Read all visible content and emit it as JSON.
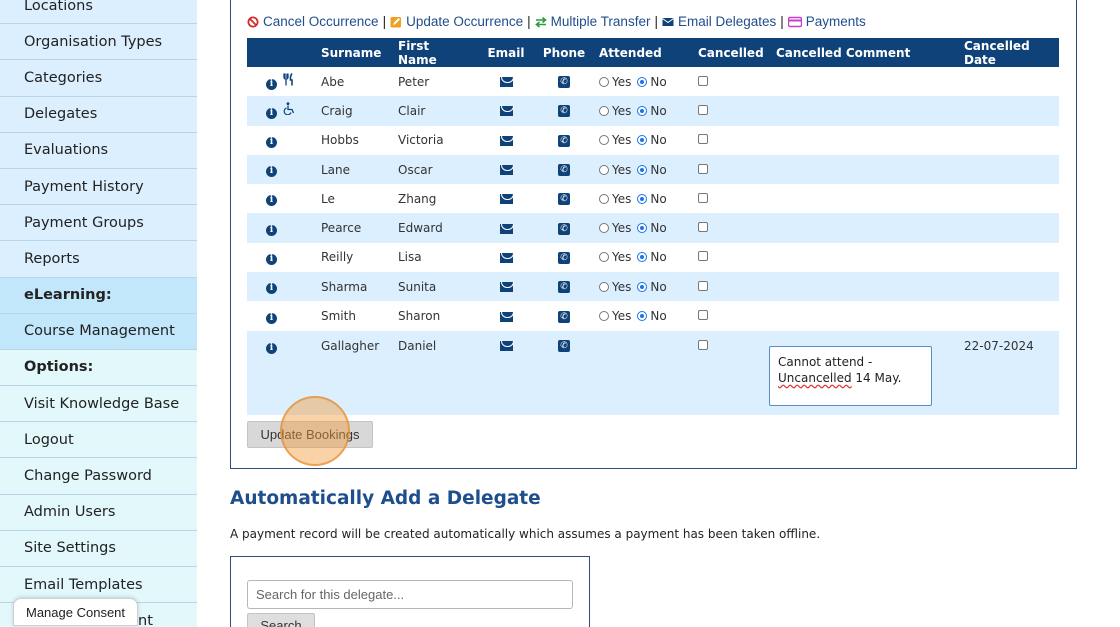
{
  "sidebar": {
    "items": [
      {
        "label": "Locations"
      },
      {
        "label": "Organisation Types"
      },
      {
        "label": "Categories"
      },
      {
        "label": "Delegates"
      },
      {
        "label": "Evaluations"
      },
      {
        "label": "Payment History"
      },
      {
        "label": "Payment Groups"
      },
      {
        "label": "Reports"
      },
      {
        "label": "eLearning:"
      },
      {
        "label": "Course Management"
      },
      {
        "label": "Options:"
      },
      {
        "label": "Visit Knowledge Base"
      },
      {
        "label": "Logout"
      },
      {
        "label": "Change Password"
      },
      {
        "label": "Admin Users"
      },
      {
        "label": "Site Settings"
      },
      {
        "label": "Email Templates"
      },
      {
        "label": "nt"
      }
    ]
  },
  "consent": {
    "label": "Manage Consent"
  },
  "toolbar": {
    "cancel": "Cancel Occurrence",
    "update": "Update Occurrence",
    "transfer": "Multiple Transfer",
    "email": "Email Delegates",
    "payments": "Payments",
    "sep": "|"
  },
  "table": {
    "headers": {
      "surname": "Surname",
      "first": "First Name",
      "email": "Email",
      "phone": "Phone",
      "attended": "Attended",
      "cancelled": "Cancelled",
      "comment": "Cancelled Comment",
      "date": "Cancelled Date"
    },
    "yes": "Yes",
    "no": "No",
    "rows": [
      {
        "surname": "Abe",
        "first": "Peter"
      },
      {
        "surname": "Craig",
        "first": "Clair"
      },
      {
        "surname": "Hobbs",
        "first": "Victoria"
      },
      {
        "surname": "Lane",
        "first": "Oscar"
      },
      {
        "surname": "Le",
        "first": "Zhang"
      },
      {
        "surname": "Pearce",
        "first": "Edward"
      },
      {
        "surname": "Reilly",
        "first": "Lisa"
      },
      {
        "surname": "Sharma",
        "first": "Sunita"
      },
      {
        "surname": "Smith",
        "first": "Sharon"
      },
      {
        "surname": "Gallagher",
        "first": "Daniel",
        "comment_line1": "Cannot attend -",
        "comment_word": "Uncancelled",
        "comment_rest": " 14 May.",
        "date": "22-07-2024"
      }
    ]
  },
  "update_button": "Update Bookings",
  "section": {
    "title": "Automatically Add a Delegate",
    "desc": "A payment record will be created automatically which assumes a payment has been taken offline.",
    "search_placeholder": "Search for this delegate...",
    "search_button": "Search"
  },
  "colors": {
    "accent": "#10427a",
    "row_alt": "#dcefff"
  },
  "icons": [
    "ban-icon",
    "edit-icon",
    "transfer-icon",
    "envelope-icon",
    "credit-card-icon",
    "info-icon",
    "cutlery-icon",
    "wheelchair-icon",
    "phone-icon"
  ]
}
